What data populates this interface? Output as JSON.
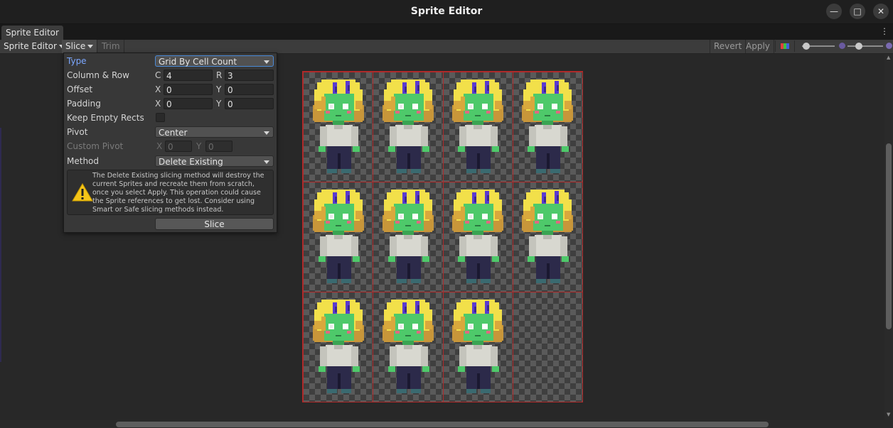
{
  "window": {
    "title": "Sprite Editor",
    "buttons": {
      "minimize": "—",
      "maximize": "□",
      "close": "✕"
    }
  },
  "tab": {
    "label": "Sprite Editor",
    "menu_icon": "⋮"
  },
  "toolbar": {
    "mode_dropdown": "Sprite Editor",
    "slice": "Slice",
    "trim": "Trim",
    "revert": "Revert",
    "apply": "Apply",
    "color_channel_icon": "rgb-channels-icon",
    "zoom_level": 0.1,
    "mip_level": 0.3
  },
  "slice_panel": {
    "type": {
      "label": "Type",
      "value": "Grid By Cell Count"
    },
    "column_row": {
      "label": "Column & Row",
      "c_label": "C",
      "c_value": "4",
      "r_label": "R",
      "r_value": "3"
    },
    "offset": {
      "label": "Offset",
      "x_label": "X",
      "x_value": "0",
      "y_label": "Y",
      "y_value": "0"
    },
    "padding": {
      "label": "Padding",
      "x_label": "X",
      "x_value": "0",
      "y_label": "Y",
      "y_value": "0"
    },
    "keep_empty_rects": {
      "label": "Keep Empty Rects",
      "checked": false
    },
    "pivot": {
      "label": "Pivot",
      "value": "Center"
    },
    "custom_pivot": {
      "label": "Custom Pivot",
      "x_label": "X",
      "x_value": "0",
      "y_label": "Y",
      "y_value": "0"
    },
    "method": {
      "label": "Method",
      "value": "Delete Existing"
    },
    "warning": "The Delete Existing slicing method will destroy the current Sprites and recreate them from scratch, once you select Apply. This operation could cause the Sprite references to get lost. Consider using Smart or Safe slicing methods instead.",
    "warning_icon": "warning-triangle-icon",
    "slice_button": "Slice"
  },
  "sprite_sheet": {
    "columns": 4,
    "rows": 3,
    "filled_cells": 11,
    "grid_color": "#b02a2a"
  },
  "colors": {
    "hair": "#f2e04a",
    "hair_shade": "#c8963a",
    "horns": "#5a3ad0",
    "skin": "#4ec96a",
    "shirt": "#d8d8d0",
    "pants": "#2c2a4a"
  }
}
